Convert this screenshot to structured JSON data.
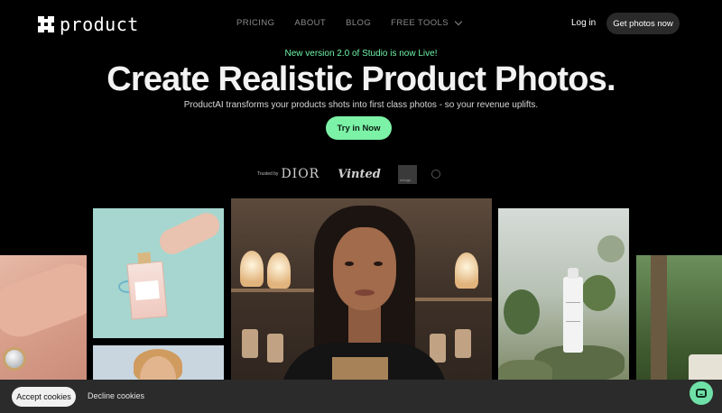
{
  "nav": {
    "logo_text": "product",
    "links": [
      "PRICING",
      "ABOUT",
      "BLOG",
      "FREE TOOLS"
    ],
    "login_label": "Log in",
    "cta_label": "Get photos now"
  },
  "hero": {
    "announcement": "New version 2.0 of Studio is now Live!",
    "headline": "Create Realistic Product Photos.",
    "subheadline": "ProductAI transforms your products shots into first class photos - so your revenue uplifts.",
    "cta_label": "Try in Now"
  },
  "trusted": {
    "label": "Trusted by",
    "brands": [
      "DIOR",
      "Vinted",
      "orange"
    ]
  },
  "cookies": {
    "accept_label": "Accept cookies",
    "decline_label": "Decline cookies"
  },
  "colors": {
    "accent": "#7cf2a6",
    "background": "#000000",
    "cookie_bar": "#2b2b2b"
  },
  "icons": {
    "logo": "logo-mark-icon",
    "dropdown": "chevron-down-icon",
    "chat": "chat-icon"
  }
}
